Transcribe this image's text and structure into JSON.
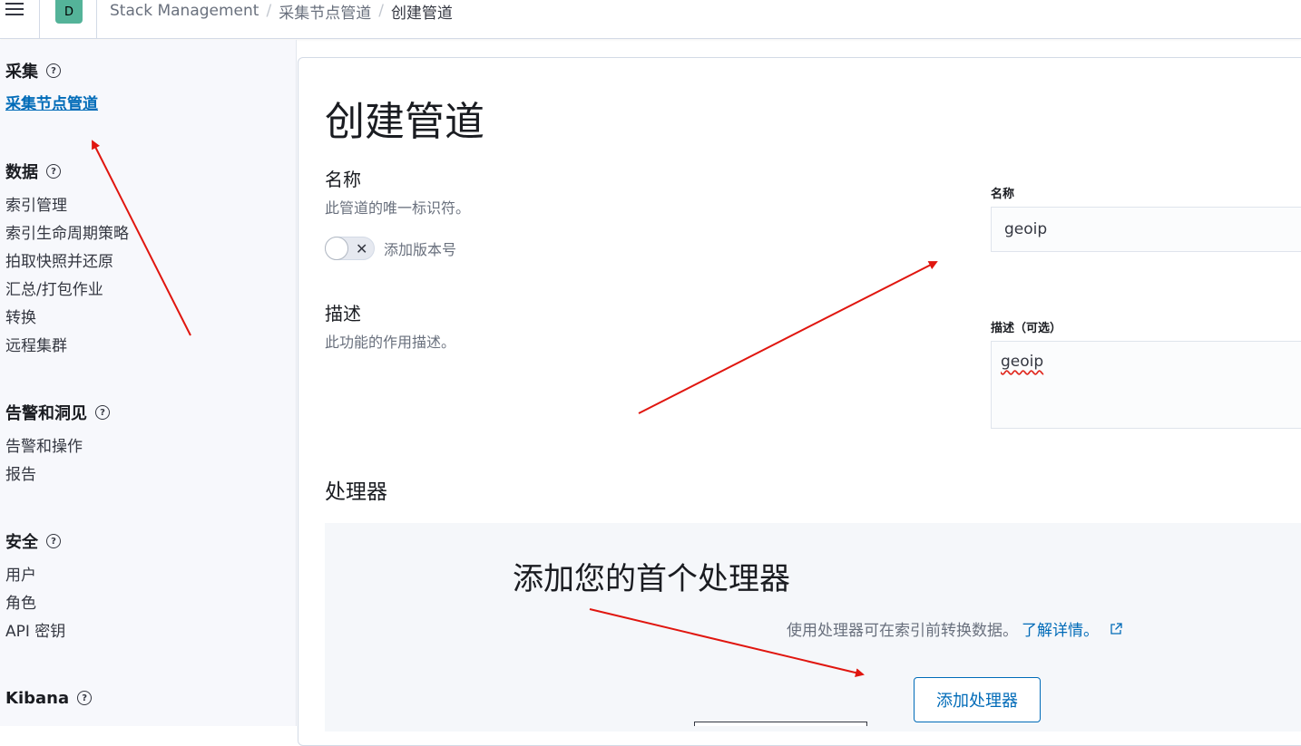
{
  "header": {
    "menu_icon": "hamburger-menu-icon",
    "space_initial": "D",
    "space_color": "#54b399",
    "breadcrumbs": [
      "Stack Management",
      "采集节点管道",
      "创建管道"
    ]
  },
  "sidebar": {
    "groups": [
      {
        "title": "采集",
        "items": [
          "采集节点管道"
        ],
        "active": "采集节点管道"
      },
      {
        "title": "数据",
        "items": [
          "索引管理",
          "索引生命周期策略",
          "拍取快照并还原",
          "汇总/打包作业",
          "转换",
          "远程集群"
        ]
      },
      {
        "title": "告警和洞见",
        "items": [
          "告警和操作",
          "报告"
        ]
      },
      {
        "title": "安全",
        "items": [
          "用户",
          "角色",
          "API 密钥"
        ]
      },
      {
        "title": "Kibana",
        "items": []
      }
    ],
    "help_glyph": "?"
  },
  "main": {
    "title": "创建管道",
    "name_section": {
      "title": "名称",
      "description": "此管道的唯一标识符。"
    },
    "version_toggle": {
      "label": "添加版本号",
      "checked": false,
      "off_glyph": "✕"
    },
    "desc_section": {
      "title": "描述",
      "description": "此功能的作用描述。"
    },
    "name_field": {
      "label": "名称",
      "value": "geoip"
    },
    "desc_field": {
      "label": "描述（可选）",
      "value": "geoip"
    },
    "processors": {
      "title": "处理器",
      "empty_title": "添加您的首个处理器",
      "empty_desc": "使用处理器可在索引前转换数据。",
      "learn_more": "了解详情。",
      "add_button": "添加处理器"
    }
  },
  "colors": {
    "accent": "#006bb8",
    "annotation_arrow": "#e0160f",
    "sidebar_bg": "#f7f8fc"
  }
}
